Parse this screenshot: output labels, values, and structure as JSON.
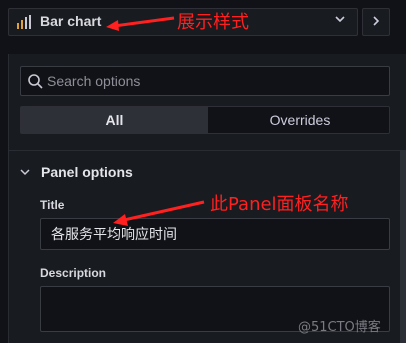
{
  "visualization": {
    "name": "Bar chart",
    "icon": "bar-chart-icon"
  },
  "annotations": {
    "viz_note": "展示样式",
    "title_note": "此Panel面板名称"
  },
  "search": {
    "placeholder": "Search options"
  },
  "tabs": [
    {
      "label": "All",
      "active": true
    },
    {
      "label": "Overrides",
      "active": false
    }
  ],
  "section": {
    "title": "Panel options",
    "expanded": true
  },
  "fields": {
    "title": {
      "label": "Title",
      "value": "各服务平均响应时间"
    },
    "description": {
      "label": "Description",
      "value": ""
    }
  },
  "watermark": "@51CTO博客",
  "colors": {
    "background": "#111217",
    "annotation": "#ff2020",
    "bar_icon": "#e0a03a"
  }
}
